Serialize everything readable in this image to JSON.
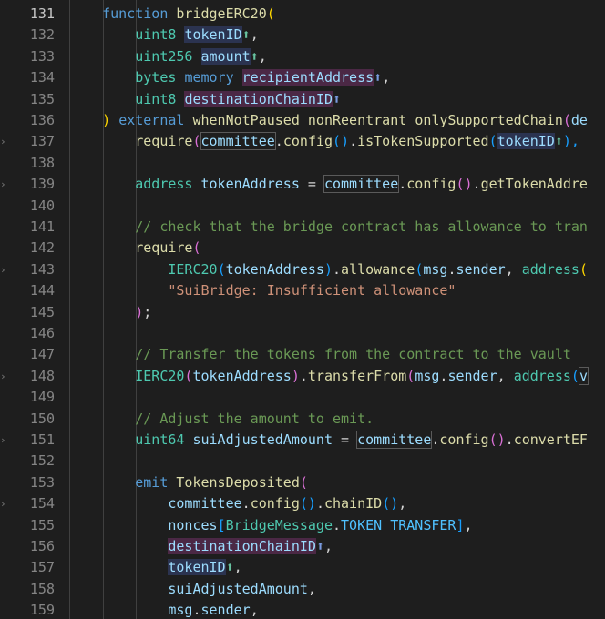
{
  "editor": {
    "lines": [
      {
        "num": "131",
        "active": true,
        "fold": false,
        "tokens": [
          {
            "t": "    ",
            "c": ""
          },
          {
            "t": "function",
            "c": "kw"
          },
          {
            "t": " ",
            "c": ""
          },
          {
            "t": "bridgeERC20",
            "c": "fn"
          },
          {
            "t": "(",
            "c": "br1"
          }
        ]
      },
      {
        "num": "132",
        "fold": false,
        "tokens": [
          {
            "t": "        ",
            "c": ""
          },
          {
            "t": "uint8",
            "c": "type"
          },
          {
            "t": " ",
            "c": ""
          },
          {
            "t": "tokenID",
            "c": "var",
            "h": "blue"
          },
          {
            "t": "⬆",
            "c": "arrow-g"
          },
          {
            "t": ",",
            "c": "pun"
          }
        ]
      },
      {
        "num": "133",
        "fold": false,
        "tokens": [
          {
            "t": "        ",
            "c": ""
          },
          {
            "t": "uint256",
            "c": "type"
          },
          {
            "t": " ",
            "c": ""
          },
          {
            "t": "amount",
            "c": "var",
            "h": "blue"
          },
          {
            "t": "⬆",
            "c": "arrow-g"
          },
          {
            "t": ",",
            "c": "pun"
          }
        ]
      },
      {
        "num": "134",
        "fold": false,
        "tokens": [
          {
            "t": "        ",
            "c": ""
          },
          {
            "t": "bytes",
            "c": "type"
          },
          {
            "t": " ",
            "c": ""
          },
          {
            "t": "memory",
            "c": "kw"
          },
          {
            "t": " ",
            "c": ""
          },
          {
            "t": "recipientAddress",
            "c": "var",
            "h": "pink"
          },
          {
            "t": "⬆",
            "c": "arrow-b"
          },
          {
            "t": ",",
            "c": "pun"
          }
        ]
      },
      {
        "num": "135",
        "fold": false,
        "tokens": [
          {
            "t": "        ",
            "c": ""
          },
          {
            "t": "uint8",
            "c": "type"
          },
          {
            "t": " ",
            "c": ""
          },
          {
            "t": "destinationChainID",
            "c": "var",
            "h": "pink"
          },
          {
            "t": "⬆",
            "c": "arrow-b"
          }
        ]
      },
      {
        "num": "136",
        "fold": false,
        "tokens": [
          {
            "t": "    ",
            "c": ""
          },
          {
            "t": ")",
            "c": "br1"
          },
          {
            "t": " ",
            "c": ""
          },
          {
            "t": "external",
            "c": "kw"
          },
          {
            "t": " ",
            "c": ""
          },
          {
            "t": "whenNotPaused",
            "c": "fn"
          },
          {
            "t": " ",
            "c": ""
          },
          {
            "t": "nonReentrant",
            "c": "fn"
          },
          {
            "t": " ",
            "c": ""
          },
          {
            "t": "onlySupportedChain",
            "c": "fn"
          },
          {
            "t": "(",
            "c": "br2"
          },
          {
            "t": "de",
            "c": "var"
          }
        ]
      },
      {
        "num": "137",
        "fold": true,
        "tokens": [
          {
            "t": "        ",
            "c": ""
          },
          {
            "t": "require",
            "c": "fn"
          },
          {
            "t": "(",
            "c": "br2"
          },
          {
            "t": "committee",
            "c": "var",
            "h": "box"
          },
          {
            "t": ".",
            "c": "pun"
          },
          {
            "t": "config",
            "c": "fn"
          },
          {
            "t": "()",
            "c": "br3"
          },
          {
            "t": ".",
            "c": "pun"
          },
          {
            "t": "isTokenSupported",
            "c": "fn"
          },
          {
            "t": "(",
            "c": "br3"
          },
          {
            "t": "tokenID",
            "c": "var",
            "h": "blue"
          },
          {
            "t": "⬆",
            "c": "arrow-g"
          },
          {
            "t": "),",
            "c": "br3"
          }
        ]
      },
      {
        "num": "138",
        "fold": false,
        "tokens": []
      },
      {
        "num": "139",
        "fold": true,
        "tokens": [
          {
            "t": "        ",
            "c": ""
          },
          {
            "t": "address",
            "c": "type"
          },
          {
            "t": " ",
            "c": ""
          },
          {
            "t": "tokenAddress",
            "c": "var"
          },
          {
            "t": " = ",
            "c": "op"
          },
          {
            "t": "committee",
            "c": "var",
            "h": "box"
          },
          {
            "t": ".",
            "c": "pun"
          },
          {
            "t": "config",
            "c": "fn"
          },
          {
            "t": "()",
            "c": "br2"
          },
          {
            "t": ".",
            "c": "pun"
          },
          {
            "t": "getTokenAddre",
            "c": "fn"
          }
        ]
      },
      {
        "num": "140",
        "fold": false,
        "tokens": []
      },
      {
        "num": "141",
        "fold": false,
        "tokens": [
          {
            "t": "        ",
            "c": ""
          },
          {
            "t": "// check that the bridge contract has allowance to tran",
            "c": "cmt"
          }
        ]
      },
      {
        "num": "142",
        "fold": false,
        "tokens": [
          {
            "t": "        ",
            "c": ""
          },
          {
            "t": "require",
            "c": "fn"
          },
          {
            "t": "(",
            "c": "br2"
          }
        ]
      },
      {
        "num": "143",
        "fold": true,
        "tokens": [
          {
            "t": "            ",
            "c": ""
          },
          {
            "t": "IERC20",
            "c": "type"
          },
          {
            "t": "(",
            "c": "br3"
          },
          {
            "t": "tokenAddress",
            "c": "var"
          },
          {
            "t": ")",
            "c": "br3"
          },
          {
            "t": ".",
            "c": "pun"
          },
          {
            "t": "allowance",
            "c": "fn"
          },
          {
            "t": "(",
            "c": "br3"
          },
          {
            "t": "msg",
            "c": "var"
          },
          {
            "t": ".",
            "c": "pun"
          },
          {
            "t": "sender",
            "c": "var"
          },
          {
            "t": ", ",
            "c": "pun"
          },
          {
            "t": "address",
            "c": "type"
          },
          {
            "t": "(",
            "c": "br1"
          }
        ]
      },
      {
        "num": "144",
        "fold": false,
        "tokens": [
          {
            "t": "            ",
            "c": ""
          },
          {
            "t": "\"SuiBridge: Insufficient allowance\"",
            "c": "str"
          }
        ]
      },
      {
        "num": "145",
        "fold": false,
        "tokens": [
          {
            "t": "        ",
            "c": ""
          },
          {
            "t": ")",
            "c": "br2"
          },
          {
            "t": ";",
            "c": "pun"
          }
        ]
      },
      {
        "num": "146",
        "fold": false,
        "tokens": []
      },
      {
        "num": "147",
        "fold": false,
        "tokens": [
          {
            "t": "        ",
            "c": ""
          },
          {
            "t": "// Transfer the tokens from the contract to the vault",
            "c": "cmt"
          }
        ]
      },
      {
        "num": "148",
        "fold": true,
        "tokens": [
          {
            "t": "        ",
            "c": ""
          },
          {
            "t": "IERC20",
            "c": "type"
          },
          {
            "t": "(",
            "c": "br2"
          },
          {
            "t": "tokenAddress",
            "c": "var"
          },
          {
            "t": ")",
            "c": "br2"
          },
          {
            "t": ".",
            "c": "pun"
          },
          {
            "t": "transferFrom",
            "c": "fn"
          },
          {
            "t": "(",
            "c": "br2"
          },
          {
            "t": "msg",
            "c": "var"
          },
          {
            "t": ".",
            "c": "pun"
          },
          {
            "t": "sender",
            "c": "var"
          },
          {
            "t": ", ",
            "c": "pun"
          },
          {
            "t": "address",
            "c": "type"
          },
          {
            "t": "(",
            "c": "br3"
          },
          {
            "t": "v",
            "c": "var",
            "h": "box"
          }
        ]
      },
      {
        "num": "149",
        "fold": false,
        "tokens": []
      },
      {
        "num": "150",
        "fold": false,
        "tokens": [
          {
            "t": "        ",
            "c": ""
          },
          {
            "t": "// Adjust the amount to emit.",
            "c": "cmt"
          }
        ]
      },
      {
        "num": "151",
        "fold": true,
        "tokens": [
          {
            "t": "        ",
            "c": ""
          },
          {
            "t": "uint64",
            "c": "type"
          },
          {
            "t": " ",
            "c": ""
          },
          {
            "t": "suiAdjustedAmount",
            "c": "var"
          },
          {
            "t": " = ",
            "c": "op"
          },
          {
            "t": "committee",
            "c": "var",
            "h": "box"
          },
          {
            "t": ".",
            "c": "pun"
          },
          {
            "t": "config",
            "c": "fn"
          },
          {
            "t": "()",
            "c": "br2"
          },
          {
            "t": ".",
            "c": "pun"
          },
          {
            "t": "convertEF",
            "c": "fn"
          }
        ]
      },
      {
        "num": "152",
        "fold": false,
        "tokens": []
      },
      {
        "num": "153",
        "fold": false,
        "tokens": [
          {
            "t": "        ",
            "c": ""
          },
          {
            "t": "emit",
            "c": "kw"
          },
          {
            "t": " ",
            "c": ""
          },
          {
            "t": "TokensDeposited",
            "c": "fn"
          },
          {
            "t": "(",
            "c": "br2"
          }
        ]
      },
      {
        "num": "154",
        "fold": true,
        "tokens": [
          {
            "t": "            ",
            "c": ""
          },
          {
            "t": "committee",
            "c": "var"
          },
          {
            "t": ".",
            "c": "pun"
          },
          {
            "t": "config",
            "c": "fn"
          },
          {
            "t": "()",
            "c": "br3"
          },
          {
            "t": ".",
            "c": "pun"
          },
          {
            "t": "chainID",
            "c": "fn"
          },
          {
            "t": "()",
            "c": "br3"
          },
          {
            "t": ",",
            "c": "pun"
          }
        ]
      },
      {
        "num": "155",
        "fold": false,
        "tokens": [
          {
            "t": "            ",
            "c": ""
          },
          {
            "t": "nonces",
            "c": "var"
          },
          {
            "t": "[",
            "c": "br3"
          },
          {
            "t": "BridgeMessage",
            "c": "type"
          },
          {
            "t": ".",
            "c": "pun"
          },
          {
            "t": "TOKEN_TRANSFER",
            "c": "const"
          },
          {
            "t": "]",
            "c": "br3"
          },
          {
            "t": ",",
            "c": "pun"
          }
        ]
      },
      {
        "num": "156",
        "fold": false,
        "tokens": [
          {
            "t": "            ",
            "c": ""
          },
          {
            "t": "destinationChainID",
            "c": "var",
            "h": "pink"
          },
          {
            "t": "⬆",
            "c": "arrow-b"
          },
          {
            "t": ",",
            "c": "pun"
          }
        ]
      },
      {
        "num": "157",
        "fold": false,
        "tokens": [
          {
            "t": "            ",
            "c": ""
          },
          {
            "t": "tokenID",
            "c": "var",
            "h": "blue"
          },
          {
            "t": "⬆",
            "c": "arrow-g"
          },
          {
            "t": ",",
            "c": "pun"
          }
        ]
      },
      {
        "num": "158",
        "fold": false,
        "tokens": [
          {
            "t": "            ",
            "c": ""
          },
          {
            "t": "suiAdjustedAmount",
            "c": "var"
          },
          {
            "t": ",",
            "c": "pun"
          }
        ]
      },
      {
        "num": "159",
        "fold": false,
        "tokens": [
          {
            "t": "            ",
            "c": ""
          },
          {
            "t": "msg",
            "c": "var"
          },
          {
            "t": ".",
            "c": "pun"
          },
          {
            "t": "sender",
            "c": "var"
          },
          {
            "t": ",",
            "c": "pun"
          }
        ]
      }
    ]
  }
}
